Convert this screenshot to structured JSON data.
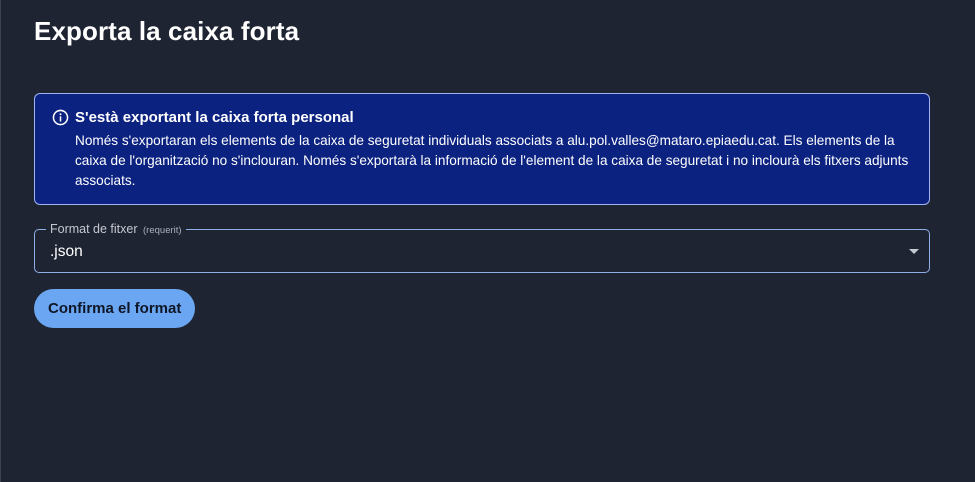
{
  "page": {
    "title": "Exporta la caixa forta"
  },
  "callout": {
    "icon": "info-icon",
    "title": "S'està exportant la caixa forta personal",
    "body": "Només s'exportaran els elements de la caixa de seguretat individuals associats a alu.pol.valles@mataro.epiaedu.cat. Els elements de la caixa de l'organització no s'inclouran. Només s'exportarà la informació de l'element de la caixa de seguretat i no inclourà els fitxers adjunts associats.",
    "background_color": "#0b2281",
    "border_color": "#9fb4f2"
  },
  "format_field": {
    "label": "Format de fitxer",
    "required_note": "(requerit)",
    "value": ".json",
    "icon": "caret-down-icon"
  },
  "confirm_button": {
    "label": "Confirma el format",
    "color": "#6aa6f2"
  }
}
